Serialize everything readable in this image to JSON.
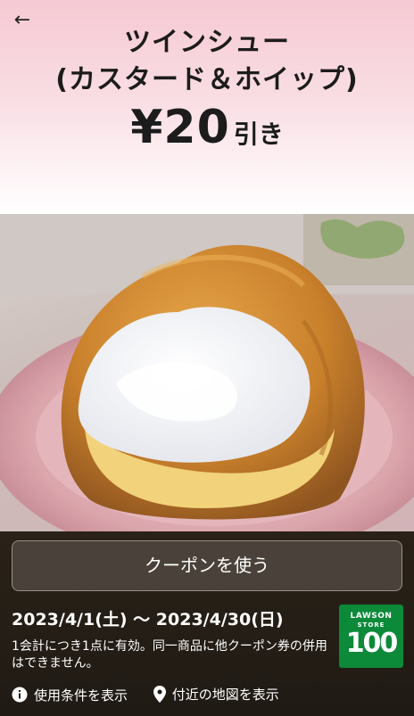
{
  "header": {
    "back_icon": "arrow-left-icon",
    "title_line1": "ツインシュー",
    "title_line2": "(カスタード＆ホイップ)",
    "price_amount": "¥20",
    "price_suffix": "引き"
  },
  "coupon": {
    "use_button_label": "クーポンを使う",
    "date_range": "2023/4/1(土) 〜 2023/4/30(日)",
    "note": "1会計につき1点に有効。同一商品に他クーポン券の併用はできません。"
  },
  "logo": {
    "line1": "LAWSON",
    "line2": "STORE",
    "line3": "100",
    "color": "#0c8a3a"
  },
  "links": {
    "terms_label": "使用条件を表示",
    "terms_icon": "info-icon",
    "map_label": "付近の地図を表示",
    "map_icon": "location-pin-icon"
  },
  "colors": {
    "header_pink": "#f6c9d3",
    "panel_dark": "#2a2218",
    "button_bg": "#4a423a"
  }
}
